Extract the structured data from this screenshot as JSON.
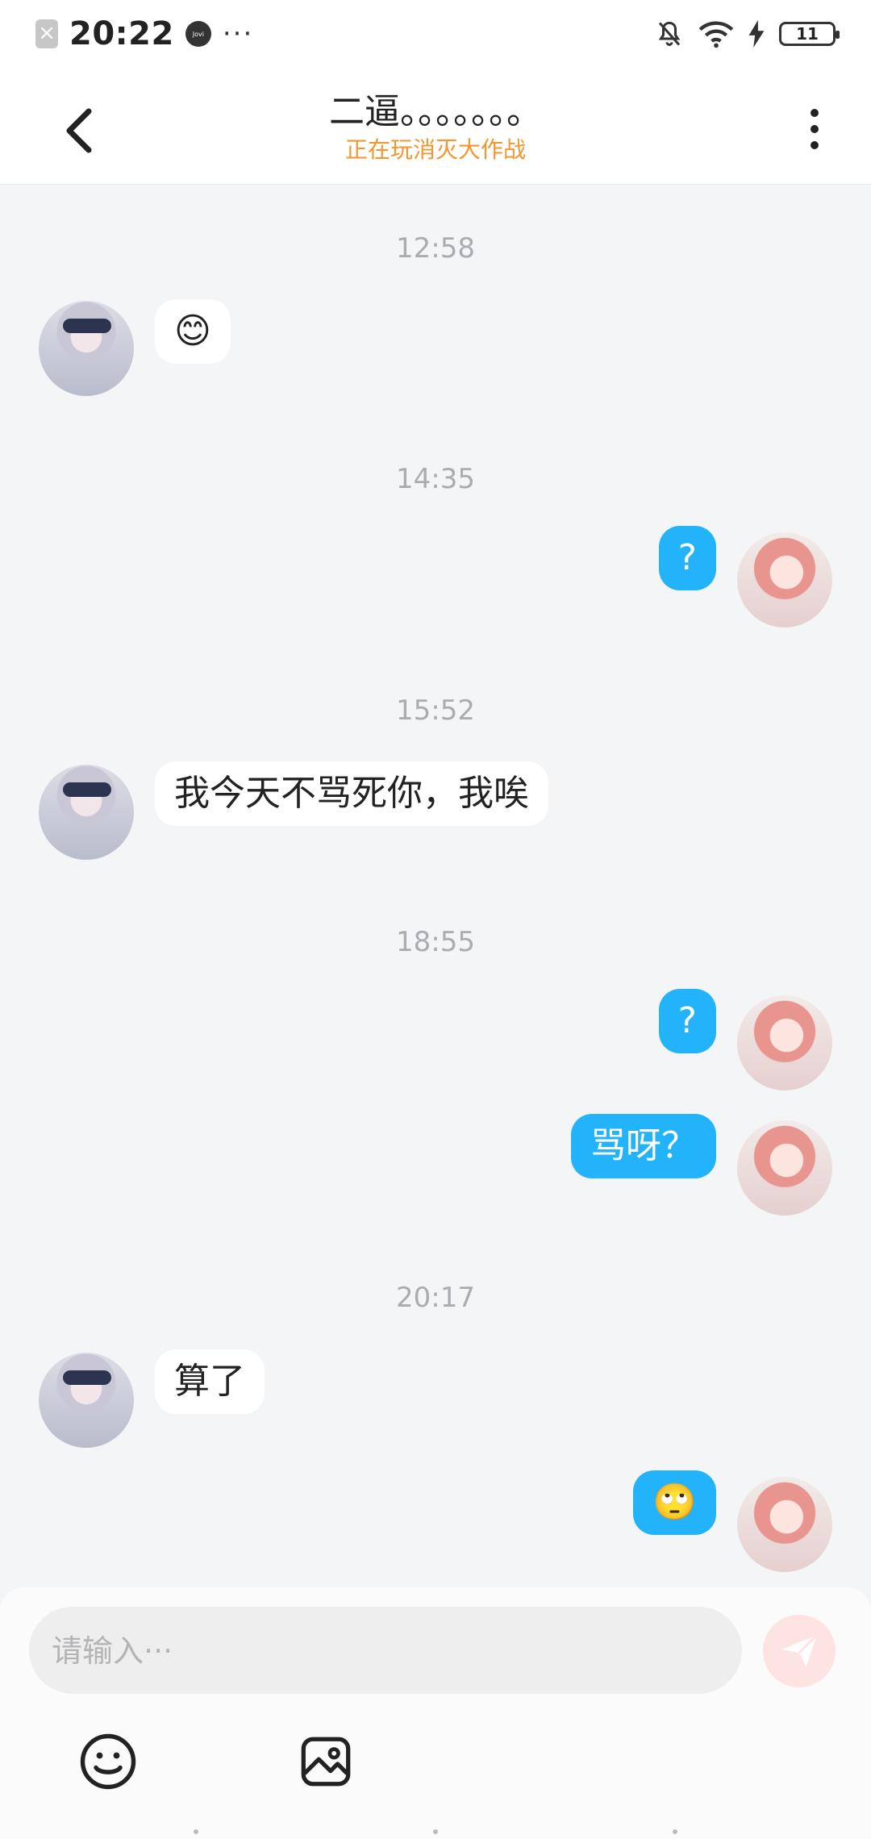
{
  "status_bar": {
    "time": "20:22",
    "more": "···",
    "jovi": "Jovi",
    "battery": "11"
  },
  "header": {
    "title": "二逼。。。。。。。",
    "subtitle": "正在玩消灭大作战"
  },
  "messages": [
    {
      "timestamp": "12:58",
      "side": "left",
      "text": "😊"
    },
    {
      "timestamp": "14:35",
      "side": "right",
      "text": "?"
    },
    {
      "timestamp": "15:52",
      "side": "left",
      "text": "我今天不骂死你，我唉"
    },
    {
      "timestamp": "18:55",
      "side": "right",
      "text": "?"
    },
    {
      "timestamp": "",
      "side": "right",
      "text": "骂呀？"
    },
    {
      "timestamp": "20:17",
      "side": "left",
      "text": "算了"
    },
    {
      "timestamp": "",
      "side": "right",
      "text": "🙄"
    }
  ],
  "composer": {
    "placeholder": "请输入···",
    "value": ""
  },
  "colors": {
    "accent_blue": "#23b3fb",
    "subtitle_orange": "#f5962c",
    "background": "#f3f5f7"
  },
  "icons": {
    "back": "chevron-left-icon",
    "more": "vertical-dots-icon",
    "send": "paper-plane-icon",
    "emoji": "smiley-icon",
    "image": "image-icon"
  }
}
